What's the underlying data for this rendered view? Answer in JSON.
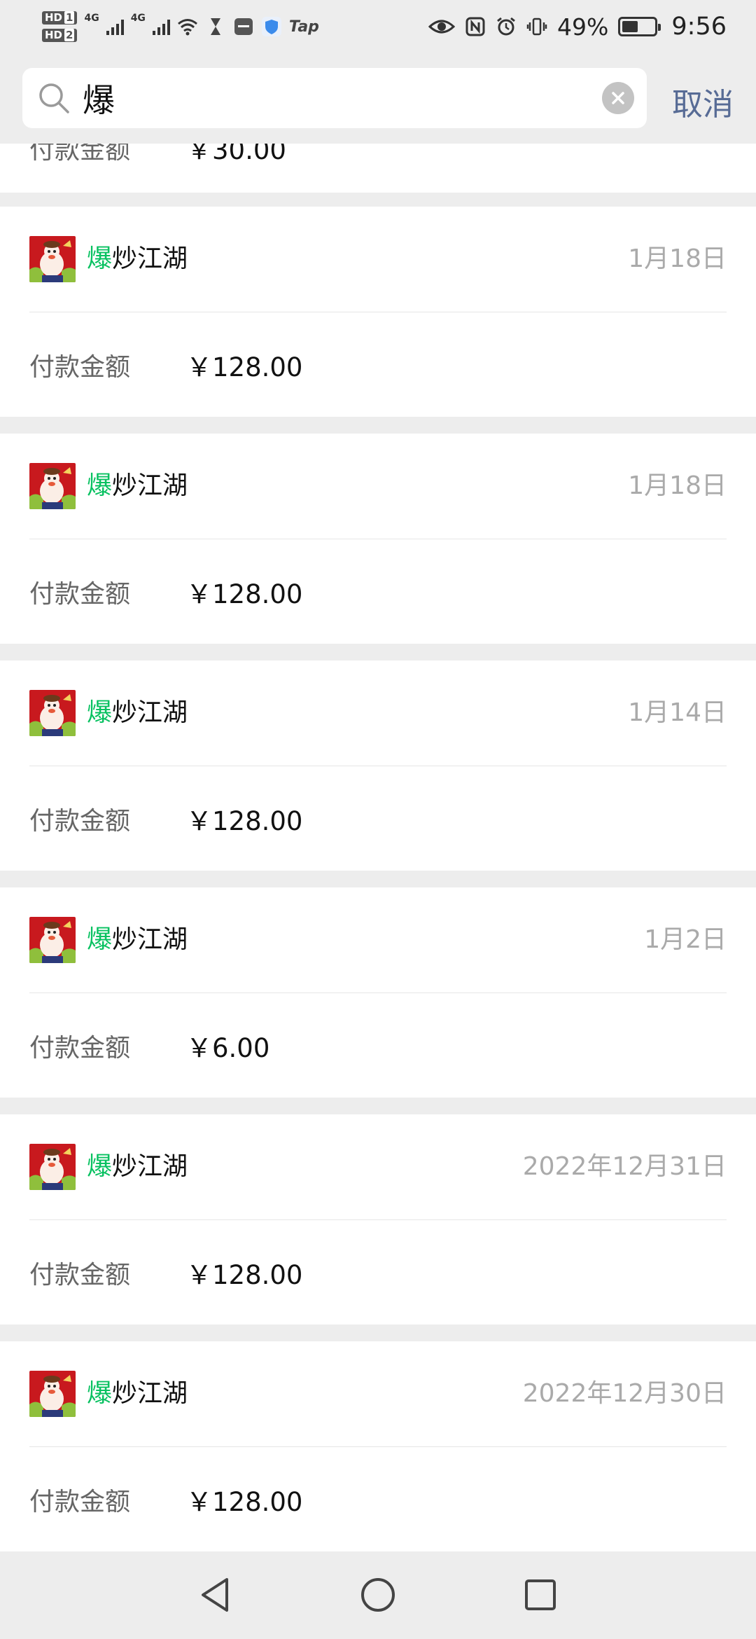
{
  "status_bar": {
    "sim1": "HD",
    "sim1_num": "1",
    "sim2": "HD",
    "sim2_num": "2",
    "net1": "4G",
    "net2": "4G",
    "tap": "Tap",
    "battery_percent": "49%",
    "battery_level": 0.49,
    "time": "9:56"
  },
  "search": {
    "query": "爆",
    "cancel_label": "取消"
  },
  "partial_item": {
    "label": "付款金额",
    "amount": "￥30.00"
  },
  "items": [
    {
      "highlight": "爆",
      "name_rest": "炒江湖",
      "date": "1月18日",
      "label": "付款金额",
      "amount": "￥128.00"
    },
    {
      "highlight": "爆",
      "name_rest": "炒江湖",
      "date": "1月18日",
      "label": "付款金额",
      "amount": "￥128.00"
    },
    {
      "highlight": "爆",
      "name_rest": "炒江湖",
      "date": "1月14日",
      "label": "付款金额",
      "amount": "￥128.00"
    },
    {
      "highlight": "爆",
      "name_rest": "炒江湖",
      "date": "1月2日",
      "label": "付款金额",
      "amount": "￥6.00"
    },
    {
      "highlight": "爆",
      "name_rest": "炒江湖",
      "date": "2022年12月31日",
      "label": "付款金额",
      "amount": "￥128.00"
    },
    {
      "highlight": "爆",
      "name_rest": "炒江湖",
      "date": "2022年12月30日",
      "label": "付款金额",
      "amount": "￥128.00"
    }
  ],
  "colors": {
    "highlight": "#07c160",
    "cancel": "#576b95",
    "background": "#ededed"
  }
}
